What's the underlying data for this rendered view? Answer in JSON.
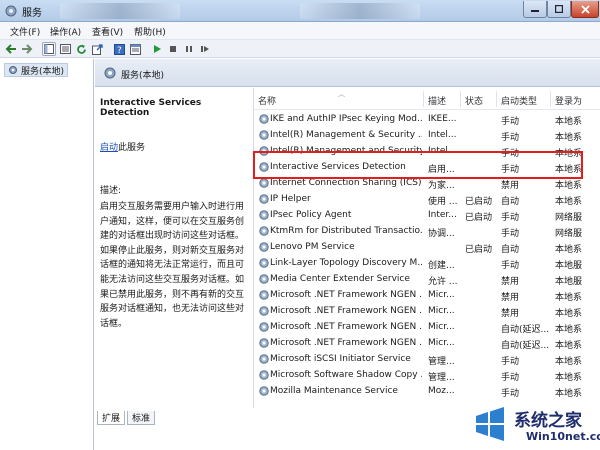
{
  "window": {
    "title": "服务"
  },
  "menu": [
    "文件(F)",
    "操作(A)",
    "查看(V)",
    "帮助(H)"
  ],
  "tree": {
    "root_label": "服务(本地)"
  },
  "content_header": {
    "title": "服务(本地)"
  },
  "details": {
    "service_name": "Interactive Services Detection",
    "start_link": "启动",
    "start_suffix": "此服务",
    "description_label": "描述:",
    "description_text": "启用交互服务需要用户输入时进行用户通知，这样，便可以在交互服务创建的对话框出现时访问这些对话框。如果停止此服务，则对新交互服务对话框的通知将无法正常运行，而且可能无法访问这些交互服务对话框。如果已禁用此服务，则不再有新的交互服务对话框通知，也无法访问这些对话框。"
  },
  "columns": [
    "名称",
    "描述",
    "状态",
    "启动类型",
    "登录为"
  ],
  "services": [
    {
      "name": "IKE and AuthIP IPsec Keying Mod...",
      "desc": "IKEE...",
      "status": "",
      "startup": "手动",
      "logon": "本地系"
    },
    {
      "name": "Intel(R) Management & Security ...",
      "desc": "Intel...",
      "status": "",
      "startup": "手动",
      "logon": "本地系"
    },
    {
      "name": "Intel(R) Management and Security ...",
      "desc": "Intel...",
      "status": "",
      "startup": "手动",
      "logon": "本地系"
    },
    {
      "name": "Interactive Services Detection",
      "desc": "启用...",
      "status": "",
      "startup": "手动",
      "logon": "本地系"
    },
    {
      "name": "Internet Connection Sharing (ICS)",
      "desc": "为家...",
      "status": "",
      "startup": "禁用",
      "logon": "本地系"
    },
    {
      "name": "IP Helper",
      "desc": "使用 ...",
      "status": "已启动",
      "startup": "自动",
      "logon": "本地系"
    },
    {
      "name": "IPsec Policy Agent",
      "desc": "Inter...",
      "status": "已启动",
      "startup": "手动",
      "logon": "网络服"
    },
    {
      "name": "KtmRm for Distributed Transactio...",
      "desc": "协调...",
      "status": "",
      "startup": "手动",
      "logon": "网络服"
    },
    {
      "name": "Lenovo PM Service",
      "desc": "",
      "status": "已启动",
      "startup": "自动",
      "logon": "本地系"
    },
    {
      "name": "Link-Layer Topology Discovery M...",
      "desc": "创建...",
      "status": "",
      "startup": "手动",
      "logon": "本地服"
    },
    {
      "name": "Media Center Extender Service",
      "desc": "允许 ...",
      "status": "",
      "startup": "禁用",
      "logon": "本地服"
    },
    {
      "name": "Microsoft .NET Framework NGEN ...",
      "desc": "Micr...",
      "status": "",
      "startup": "禁用",
      "logon": "本地系"
    },
    {
      "name": "Microsoft .NET Framework NGEN ...",
      "desc": "Micr...",
      "status": "",
      "startup": "禁用",
      "logon": "本地系"
    },
    {
      "name": "Microsoft .NET Framework NGEN ...",
      "desc": "Micr...",
      "status": "",
      "startup": "自动(延迟...",
      "logon": "本地系"
    },
    {
      "name": "Microsoft .NET Framework NGEN ...",
      "desc": "Micr...",
      "status": "",
      "startup": "自动(延迟...",
      "logon": "本地系"
    },
    {
      "name": "Microsoft iSCSI Initiator Service",
      "desc": "管理...",
      "status": "",
      "startup": "手动",
      "logon": "本地系"
    },
    {
      "name": "Microsoft Software Shadow Copy ...",
      "desc": "管理...",
      "status": "",
      "startup": "手动",
      "logon": "本地系"
    },
    {
      "name": "Mozilla Maintenance Service",
      "desc": "Moz...",
      "status": "",
      "startup": "手动",
      "logon": "本地系"
    }
  ],
  "bottom_tabs": [
    "扩展",
    "标准"
  ],
  "watermark": {
    "text": "系统之家",
    "url": "Win10net.com"
  }
}
